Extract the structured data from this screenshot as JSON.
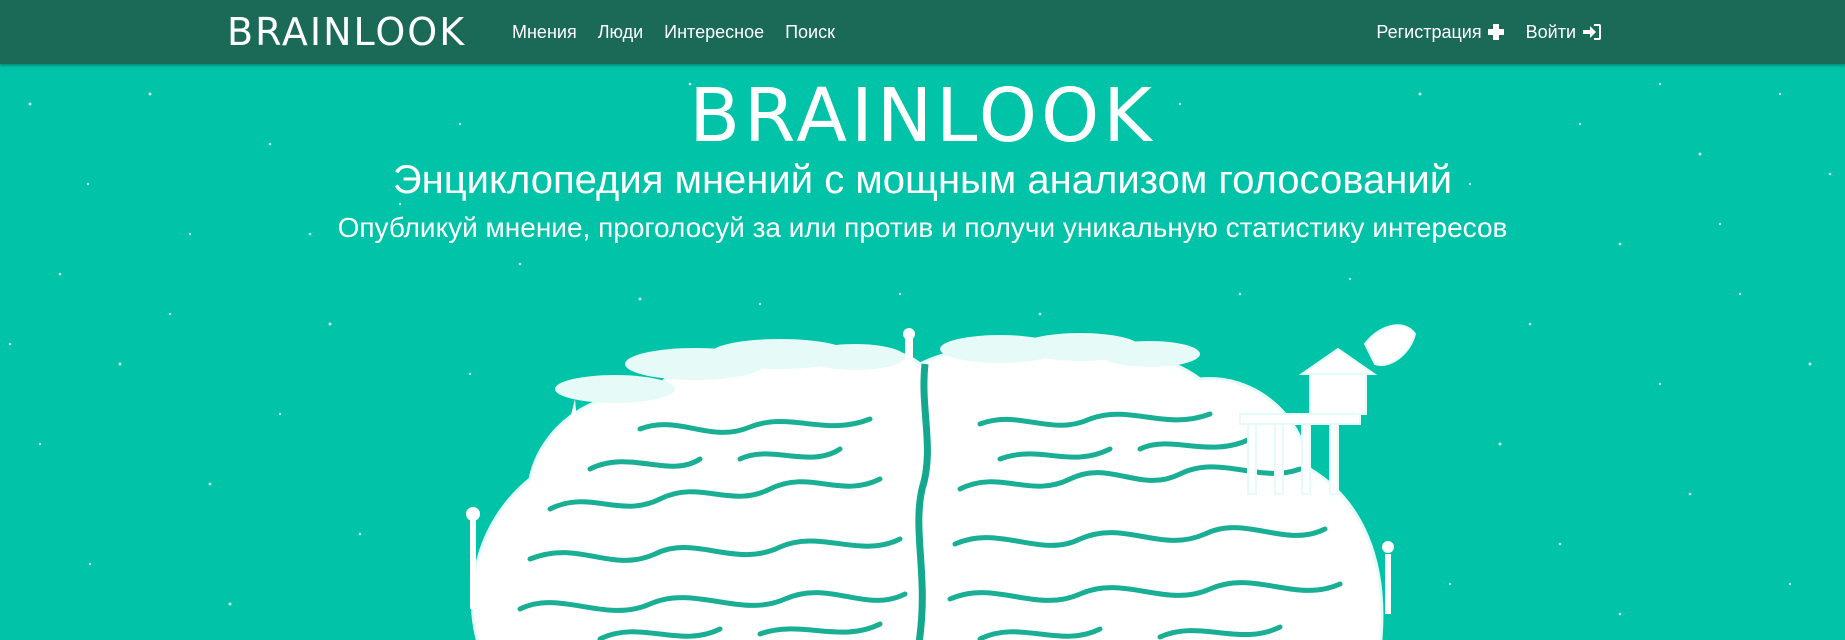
{
  "navbar": {
    "brand": "BRAINLOOK",
    "links": [
      "Мнения",
      "Люди",
      "Интересное",
      "Поиск"
    ],
    "register_label": "Регистрация",
    "login_label": "Войти",
    "background_color": "#1b6a58"
  },
  "hero": {
    "title": "BRAINLOOK",
    "subtitle": "Энциклопедия мнений с мощным анализом голосований",
    "tagline": "Опубликуй мнение, проголосуй за или против и получи уникальную статистику интересов",
    "background_color": "#00c3a8",
    "illustration": "brain-island-illustration"
  },
  "icons": {
    "register": "plus-icon",
    "login": "sign-in-icon"
  }
}
